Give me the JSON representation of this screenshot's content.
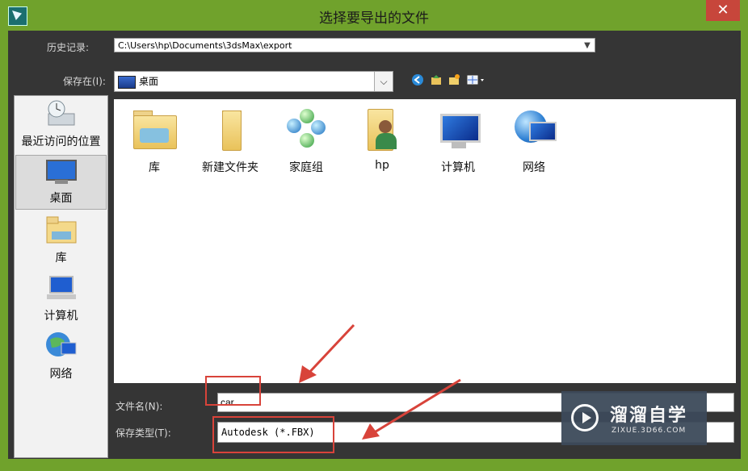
{
  "window": {
    "title": "选择要导出的文件",
    "close": "✕"
  },
  "history": {
    "label": "历史记录:",
    "value": "C:\\Users\\hp\\Documents\\3dsMax\\export"
  },
  "savein": {
    "label": "保存在(I):",
    "value": "桌面"
  },
  "places": [
    {
      "label": "最近访问的位置",
      "icon": "recent-places-icon"
    },
    {
      "label": "桌面",
      "icon": "desktop-icon"
    },
    {
      "label": "库",
      "icon": "libraries-icon"
    },
    {
      "label": "计算机",
      "icon": "computer-icon"
    },
    {
      "label": "网络",
      "icon": "network-icon"
    }
  ],
  "files": [
    {
      "label": "库",
      "icon": "libraries-folder-icon"
    },
    {
      "label": "新建文件夹",
      "icon": "folder-icon"
    },
    {
      "label": "家庭组",
      "icon": "homegroup-icon"
    },
    {
      "label": "hp",
      "icon": "user-folder-icon"
    },
    {
      "label": "计算机",
      "icon": "computer-icon"
    },
    {
      "label": "网络",
      "icon": "network-icon"
    }
  ],
  "filename": {
    "label": "文件名(N):",
    "value": "car"
  },
  "filetype": {
    "label": "保存类型(T):",
    "value": "Autodesk (*.FBX)"
  },
  "watermark": {
    "title": "溜溜自学",
    "sub": "ZIXUE.3D66.COM"
  },
  "colors": {
    "frame": "#70a22c",
    "client": "#353535",
    "close": "#c7463b",
    "highlight": "#d8433a"
  }
}
